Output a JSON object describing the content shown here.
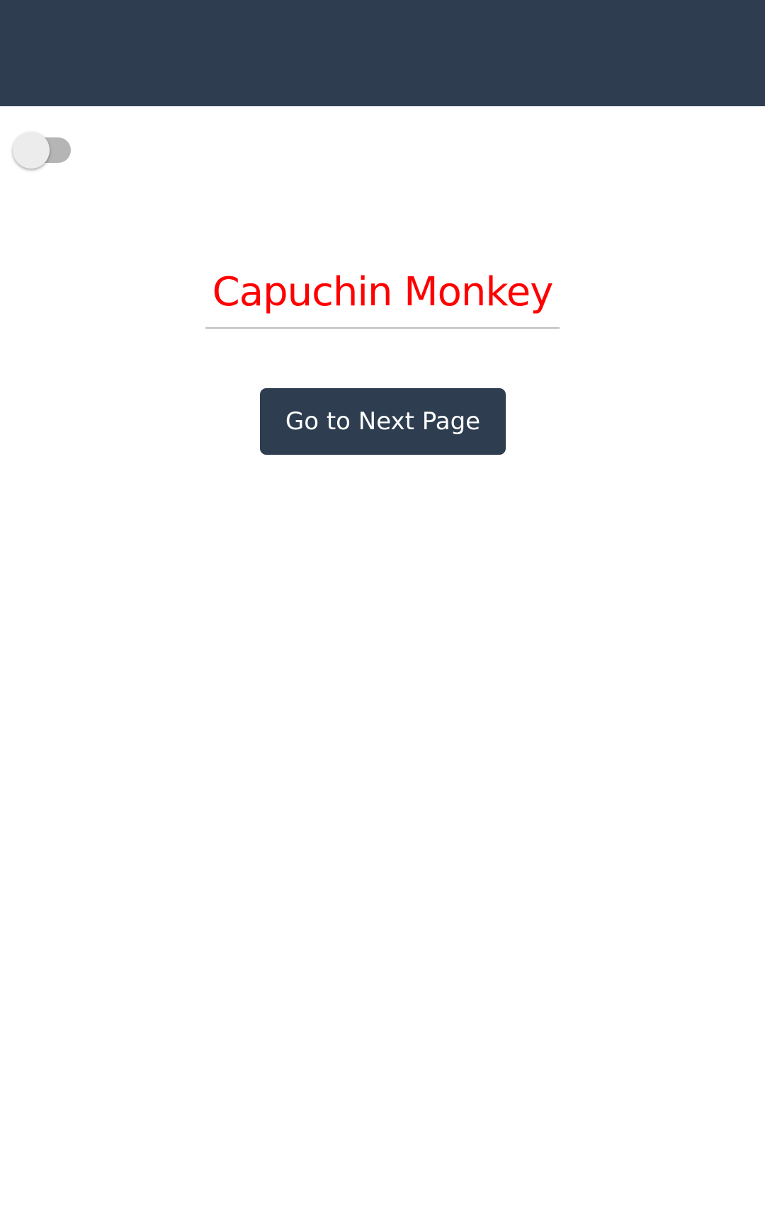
{
  "colors": {
    "app_bar": "#2e3e50",
    "title_text": "#ff0000",
    "button_background": "#2e3e50",
    "button_text": "#ffffff",
    "toggle_track": "#b5b5b5",
    "toggle_thumb": "#ececec"
  },
  "toggle": {
    "state": "off"
  },
  "title_field": {
    "value": "Capuchin Monkey"
  },
  "next_button": {
    "label": "Go to Next Page"
  }
}
